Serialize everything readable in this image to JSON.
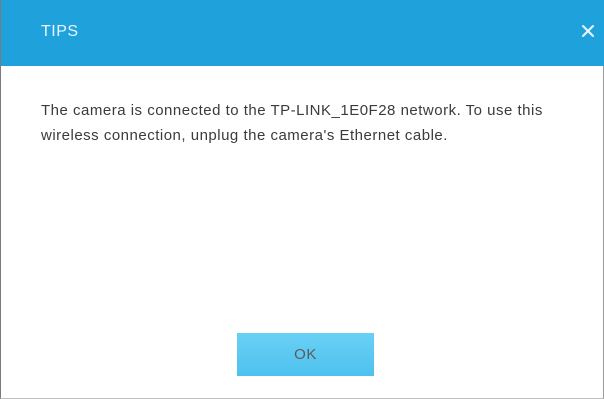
{
  "dialog": {
    "title": "TIPS",
    "close_icon": "close-icon",
    "message": "The camera is connected to the TP-LINK_1E0F28 network. To use this wireless connection, unplug the camera's Ethernet cable.",
    "ok_label": "OK"
  },
  "colors": {
    "titlebar": "#1fa2dc",
    "button": "#5bc8f1",
    "text": "#3b3b3b"
  }
}
